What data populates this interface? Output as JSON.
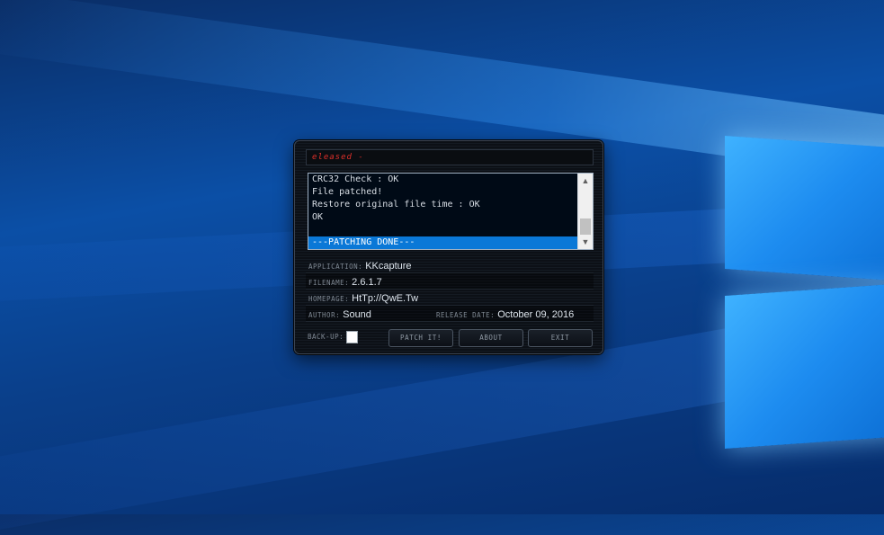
{
  "window": {
    "title": "eleased -",
    "log": {
      "lines": [
        "CRC32 Check : OK",
        "File patched!",
        "Restore original file time : OK",
        "OK"
      ],
      "selected_line": "---PATCHING DONE---"
    },
    "info": {
      "application_label": "APPLICATION:",
      "application_value": "KKcapture",
      "filename_label": "FILENAME:",
      "filename_value": "2.6.1.7",
      "homepage_label": "HOMEPAGE:",
      "homepage_value": "HtTp://QwE.Tw",
      "author_label": "AUTHOR:",
      "author_value": "Sound",
      "release_date_label": "RELEASE DATE:",
      "release_date_value": "October 09, 2016"
    },
    "backup_label": "BACK-UP:",
    "backup_checked": false,
    "buttons": {
      "patch": "PATCH IT!",
      "about": "ABOUT",
      "exit": "EXIT"
    }
  },
  "icons": {
    "scroll_up": "chevron-up-icon",
    "scroll_down": "chevron-down-icon"
  },
  "colors": {
    "title_text": "#e0302a",
    "selection": "#0a78d7"
  }
}
